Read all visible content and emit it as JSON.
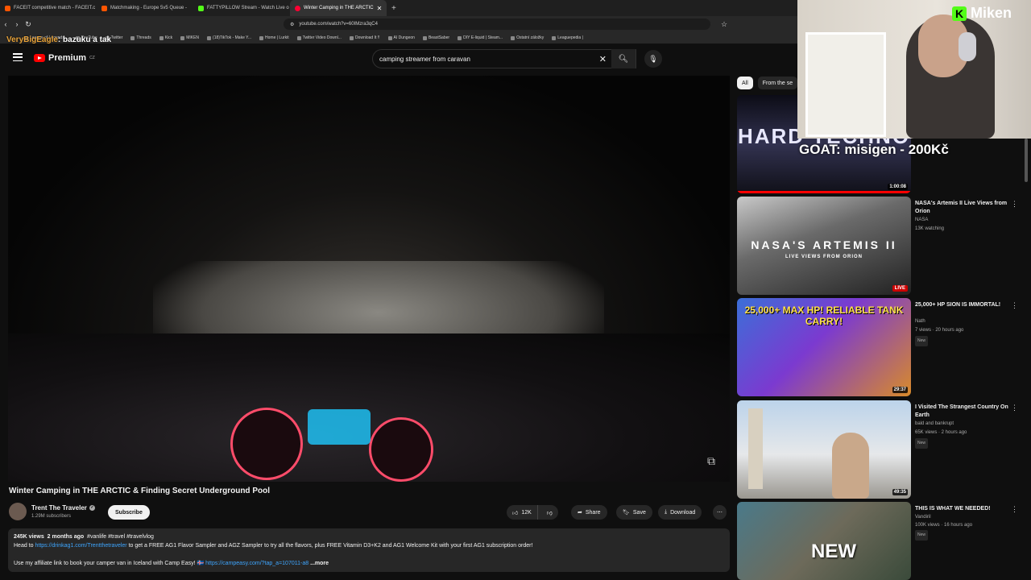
{
  "browser": {
    "tabs": [
      {
        "title": "FACEIT competitive match - FACEIT.c",
        "color": "#ff5500"
      },
      {
        "title": "Matchmaking - Europe 5v5 Queue - ",
        "color": "#ff5500"
      },
      {
        "title": "FATTYPILLOW Stream - Watch Live o",
        "color": "#53fc18"
      },
      {
        "title": "Winter Camping in THE ARCTIC",
        "color": "#ff0033"
      }
    ],
    "url": "youtube.com/watch?v=60IMzra3qC4",
    "bookmarks": [
      "League of Legends...",
      "YouTube",
      "Twitter",
      "Threads",
      "Kick",
      "MIKEN",
      "(18)TikTok - Make Y...",
      "Home | Lurkit",
      "Twitter Video Downl...",
      "Download It !!",
      "AI Dungeon",
      "BeastSaber",
      "DIY E-liquid | Steam...",
      "Ostatní záložky",
      "Leaguepedia |"
    ]
  },
  "chat_overlay": {
    "user": "VeryBigEagle",
    "message": ": bazuku a tak"
  },
  "youtube": {
    "logo": "Premium",
    "region": "CZ",
    "search_query": "camping streamer from caravan"
  },
  "video": {
    "title": "Winter Camping in THE ARCTIC & Finding Secret Underground Pool",
    "channel": "Trent The Traveler",
    "subscribers": "1.29M subscribers",
    "subscribe_label": "Subscribe",
    "likes": "12K",
    "share_label": "Share",
    "save_label": "Save",
    "download_label": "Download",
    "description": {
      "views": "245K views",
      "age": "2 months ago",
      "tags": "#vanlife #travel #travelvlog",
      "line1_prefix": "Head to",
      "line1_link": "https://drinkag1.com/Trentthetraveler",
      "line1_suffix": "to get a FREE AG1 Flavor Sampler and AGZ Sampler to try all the flavors, plus FREE Vitamin D3+K2 and AG1 Welcome Kit with your first AG1 subscription order!",
      "line2_prefix": "Use my affiliate link to book your camper van in Iceland with Camp Easy! 🇮🇸",
      "line2_link": "https://campeasy.com/?tap_a=107011-a8",
      "more": "...more"
    }
  },
  "chips": [
    "All",
    "From the se"
  ],
  "recommendations": [
    {
      "title": "",
      "duration": "1:00:08",
      "thumb_text": "HARD TECHNO"
    },
    {
      "title": "NASA's Artemis II Live Views from Orion",
      "channel": "NASA",
      "meta": "13K watching",
      "live": "LIVE",
      "thumb_text": "NASA'S ARTEMIS II",
      "thumb_sub": "LIVE VIEWS FROM ORION"
    },
    {
      "title": "25,000+ HP SION IS IMMORTAL!",
      "channel": "Nath",
      "meta": "7 views · 20 hours ago",
      "badge": "New",
      "duration": "29:37",
      "thumb_text": "25,000+ MAX HP! RELIABLE TANK CARRY!"
    },
    {
      "title": "I Visited The Strangest Country On Earth",
      "channel": "bald and bankrupt",
      "meta": "65K views · 2 hours ago",
      "badge": "New",
      "duration": "49:35"
    },
    {
      "title": "THIS IS WHAT WE NEEDED!",
      "channel": "Vandiril",
      "meta": "100K views · 16 hours ago",
      "badge": "New",
      "thumb_text": "NEW"
    }
  ],
  "stream": {
    "brand": "Miken",
    "goal": "GOAT: misigen - 200Kč"
  }
}
